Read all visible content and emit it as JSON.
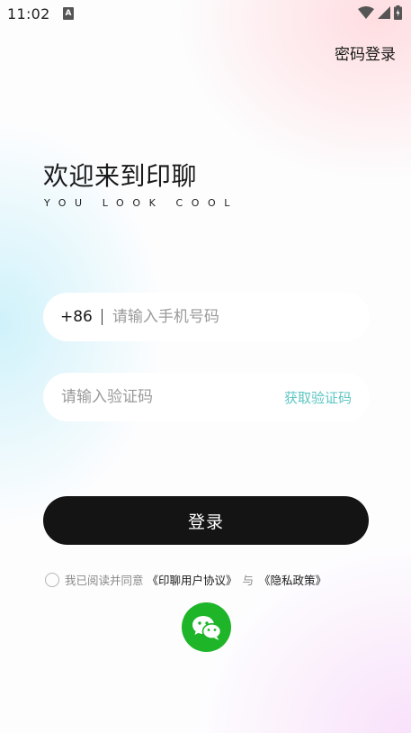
{
  "status_bar": {
    "time": "11:02",
    "notification_letter": "A"
  },
  "header": {
    "password_login": "密码登录"
  },
  "welcome": {
    "title": "欢迎来到印聊",
    "subtitle": "YOU LOOK COOL"
  },
  "phone_field": {
    "country_code": "+86",
    "value": "",
    "placeholder": "请输入手机号码"
  },
  "code_field": {
    "value": "",
    "placeholder": "请输入验证码",
    "get_code_label": "获取验证码"
  },
  "login_button": {
    "label": "登录"
  },
  "agreement": {
    "checked": false,
    "prefix": "我已阅读并同意",
    "user_agreement": "《印聊用户协议》",
    "and": "与",
    "privacy_policy": "《隐私政策》"
  },
  "social_login": {
    "icon": "wechat-icon"
  },
  "colors": {
    "accent": "#5cc6c3",
    "button_bg": "#141414",
    "wechat_green": "#1eb529"
  }
}
